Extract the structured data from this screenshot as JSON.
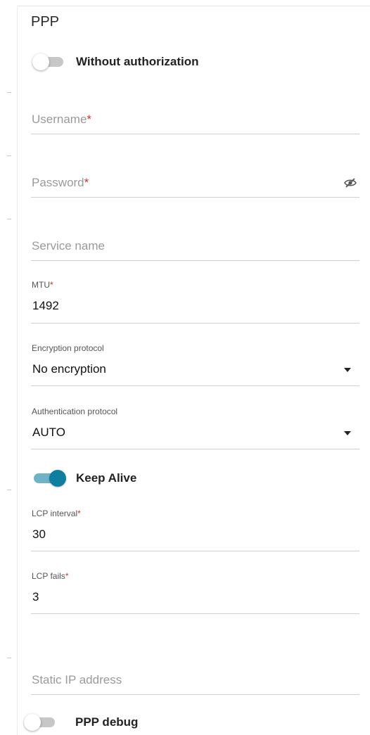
{
  "section": {
    "title": "PPP"
  },
  "without_auth": {
    "label": "Without authorization",
    "enabled": false
  },
  "username": {
    "placeholder": "Username",
    "required_mark": "*"
  },
  "password": {
    "placeholder": "Password",
    "required_mark": "*",
    "visibility_icon": "eye-slash-icon"
  },
  "service_name": {
    "placeholder": "Service name"
  },
  "mtu": {
    "label": "MTU",
    "required_mark": "*",
    "value": "1492"
  },
  "encryption": {
    "label": "Encryption protocol",
    "value": "No encryption"
  },
  "authentication": {
    "label": "Authentication protocol",
    "value": "AUTO"
  },
  "keep_alive": {
    "label": "Keep Alive",
    "enabled": true
  },
  "lcp_interval": {
    "label": "LCP interval",
    "required_mark": "*",
    "value": "30"
  },
  "lcp_fails": {
    "label": "LCP fails",
    "required_mark": "*",
    "value": "3"
  },
  "static_ip": {
    "placeholder": "Static IP address"
  },
  "ppp_debug": {
    "label": "PPP debug",
    "enabled": false
  },
  "colors": {
    "accent": "#0e7fa0",
    "accent_track": "#6fb3c7",
    "required": "#c0392b",
    "toggle_off": "#c7c7c7"
  }
}
